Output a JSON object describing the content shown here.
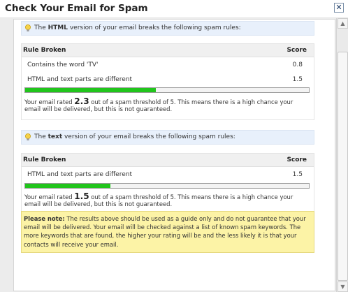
{
  "dialog": {
    "title": "Check Your Email for Spam",
    "close_label": "✕"
  },
  "html_section": {
    "prefix": "The ",
    "emphasis": "HTML",
    "suffix": " version of your email breaks the following spam rules:",
    "col_rule": "Rule Broken",
    "col_score": "Score",
    "rows": [
      {
        "rule": "Contains the word 'TV'",
        "score": "0.8"
      },
      {
        "rule": "HTML and text parts are different",
        "score": "1.5"
      }
    ],
    "bar_fraction": 0.46,
    "rated_prefix": "Your email rated ",
    "rated_value": "2.3",
    "rated_suffix": " out of a spam threshold of 5. This means there is a high chance your email will be delivered, but this is not guaranteed."
  },
  "text_section": {
    "prefix": "The ",
    "emphasis": "text",
    "suffix": " version of your email breaks the following spam rules:",
    "col_rule": "Rule Broken",
    "col_score": "Score",
    "rows": [
      {
        "rule": "HTML and text parts are different",
        "score": "1.5"
      }
    ],
    "bar_fraction": 0.3,
    "rated_prefix": "Your email rated ",
    "rated_value": "1.5",
    "rated_suffix": " out of a spam threshold of 5. This means there is a high chance your email will be delivered, but this is not guaranteed."
  },
  "note": {
    "label": "Please note:",
    "text": " The results above should be used as a guide only and do not guarantee that your email will be delivered. Your email will be checked against a list of known spam keywords. The more keywords that are found, the higher your rating will be and the less likely it is that your contacts will receive your email."
  },
  "colors": {
    "bar_fill": "#21c51c",
    "note_bg": "#fcf3a6",
    "header_bg": "#e8f0fb"
  },
  "icons": {
    "close": "close-icon",
    "tip": "lightbulb-icon",
    "scroll_up": "arrow-up-icon",
    "scroll_down": "arrow-down-icon"
  }
}
